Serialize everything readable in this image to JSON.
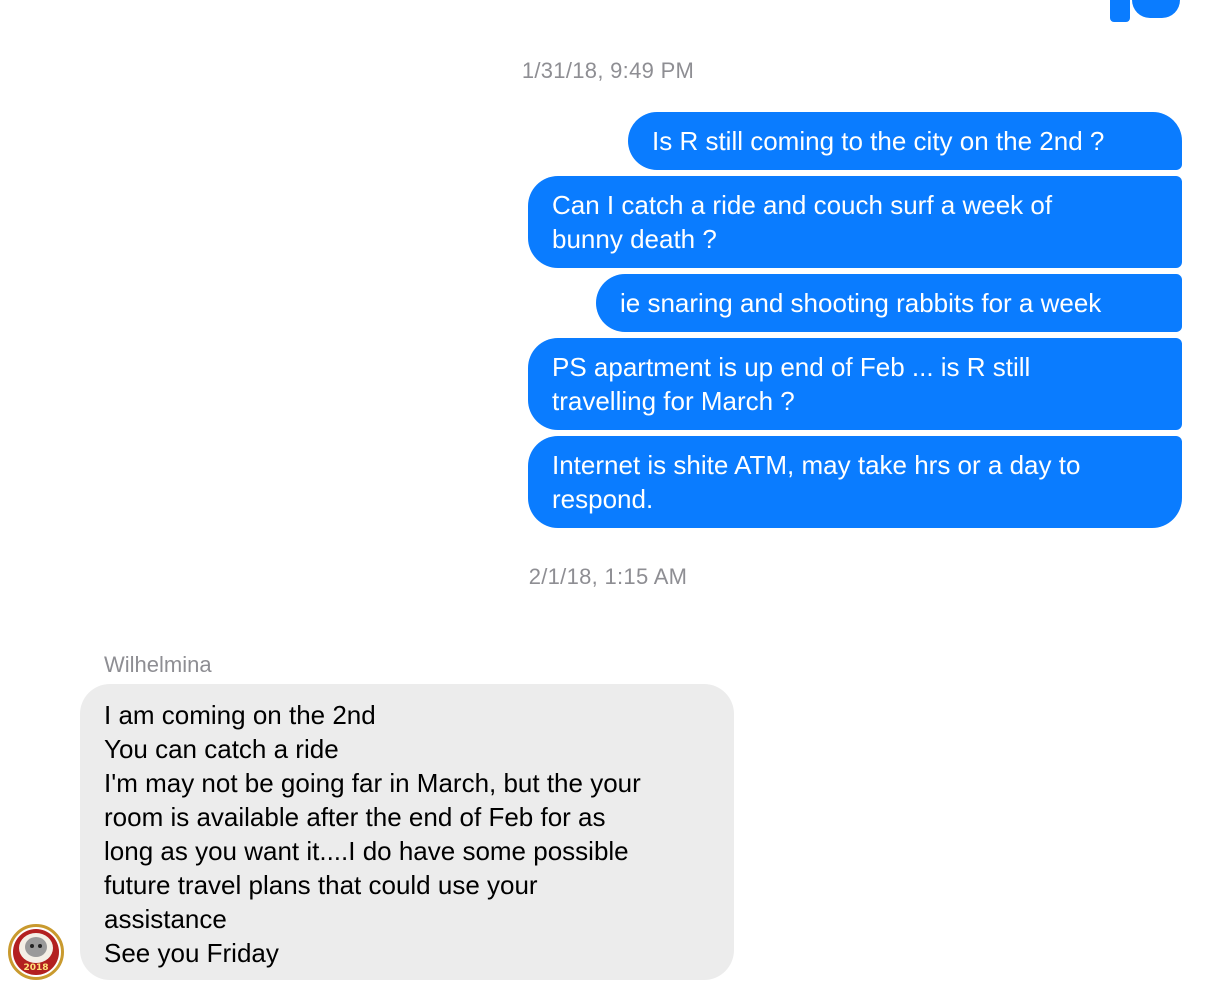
{
  "conversation": {
    "timestamps": [
      "1/31/18, 9:49 PM",
      "2/1/18, 1:15 AM"
    ],
    "outgoing": [
      [
        "Is R still coming to the city on the 2nd ?"
      ],
      [
        "Can  I catch a ride and couch surf a week of",
        "bunny death ?"
      ],
      [
        "ie snaring and shooting rabbits for a week"
      ],
      [
        "PS apartment is up end of Feb ... is R still",
        "travelling for March ?"
      ],
      [
        "Internet is shite ATM, may take hrs or a day to",
        "respond."
      ]
    ],
    "incoming": {
      "sender": "Wilhelmina",
      "lines": [
        "I am coming on the 2nd",
        "You can catch a ride",
        "I'm may not be going far in March, but the your",
        "room is available after the end of Feb for as",
        "long as you want it....I do have some possible",
        "future travel plans that could use your",
        "assistance",
        "See you Friday"
      ],
      "avatar": {
        "badge_text": "2018"
      }
    }
  },
  "colors": {
    "outgoing_bubble": "#0a7cff",
    "incoming_bubble": "#ececec",
    "timestamp_text": "#8e8e93"
  }
}
